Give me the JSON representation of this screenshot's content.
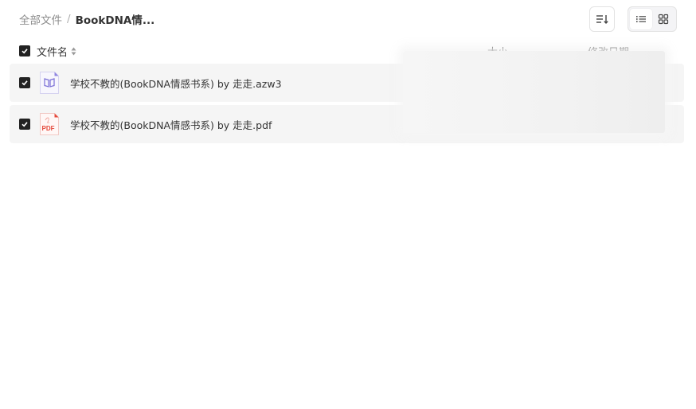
{
  "breadcrumb": {
    "root": "全部文件",
    "separator": "/",
    "current": "BookDNA情..."
  },
  "toolbar": {
    "sort_icon": "sort-list-icon",
    "view_list_icon": "list-view-icon",
    "view_grid_icon": "grid-view-icon",
    "active_view": "list"
  },
  "table": {
    "columns": {
      "name": "文件名",
      "size": "大小",
      "date": "修改日期"
    },
    "header_checked": true,
    "rows": [
      {
        "name": "学校不教的(BookDNA情感书系) by 走走.azw3",
        "icon": "ebook-file-icon",
        "checked": true
      },
      {
        "name": "学校不教的(BookDNA情感书系) by 走走.pdf",
        "icon": "pdf-file-icon",
        "icon_label": "PDF",
        "checked": true
      }
    ]
  },
  "colors": {
    "row_background": "#f5f5f5",
    "checkbox": "#222222",
    "ebook_icon": "#7a6fd6",
    "pdf_icon": "#e5483a"
  }
}
